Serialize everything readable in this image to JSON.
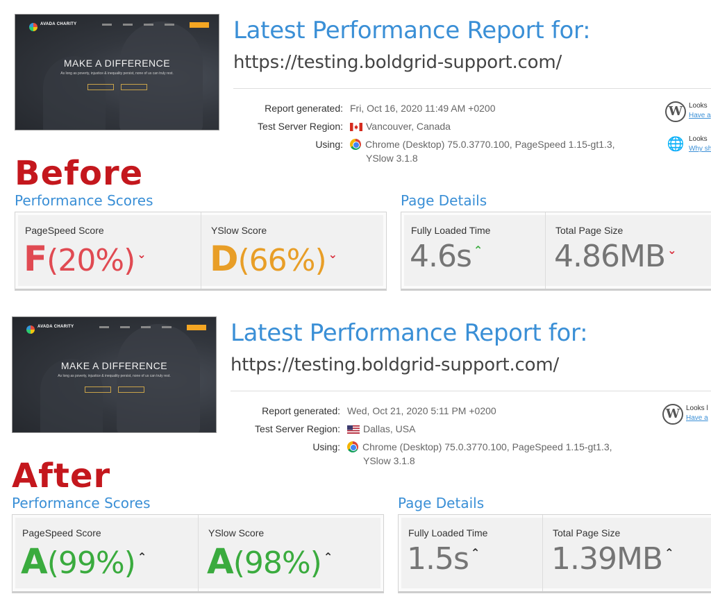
{
  "colors": {
    "accent": "#3a8fd6",
    "stage": "#c4171d",
    "grade_f": "#e04a52",
    "grade_d": "#e89e27",
    "grade_a": "#3aab3e",
    "neutral_value": "#757575",
    "arrow_up": "#3aab3e",
    "arrow_down": "#d9303e"
  },
  "before": {
    "thumb": {
      "brand": "AVADA CHARITY",
      "hero_title": "MAKE A DIFFERENCE",
      "hero_sub": "As long as poverty, injustice & inequality persist, none of us can truly rest."
    },
    "title": "Latest Performance Report for:",
    "url": "https://testing.boldgrid-support.com/",
    "report_label": "Report generated:",
    "report_value": "Fri, Oct 16, 2020 11:49 AM +0200",
    "region_label": "Test Server Region:",
    "region_value": "Vancouver, Canada",
    "region_flag": "canada-flag-icon",
    "using_label": "Using:",
    "using_line1": "Chrome (Desktop) 75.0.3770.100, PageSpeed 1.15-gt1.3,",
    "using_line2": "YSlow 3.1.8",
    "side1_text": "Looks",
    "side1_link": "Have a",
    "side2_text": "Looks",
    "side2_link": "Why sh",
    "stage_label": "Before",
    "perf_heading": "Performance Scores",
    "page_heading": "Page Details",
    "pagespeed_label": "PageSpeed Score",
    "pagespeed_grade": "F",
    "pagespeed_pct": "(20%)",
    "pagespeed_trend": "down",
    "yslow_label": "YSlow Score",
    "yslow_grade": "D",
    "yslow_pct": "(66%)",
    "yslow_trend": "down",
    "loaded_label": "Fully Loaded Time",
    "loaded_value": "4.6s",
    "loaded_trend": "up",
    "size_label": "Total Page Size",
    "size_value": "4.86MB",
    "size_trend": "down"
  },
  "after": {
    "thumb": {
      "brand": "AVADA CHARITY",
      "hero_title": "MAKE A DIFFERENCE",
      "hero_sub": "As long as poverty, injustice & inequality persist, none of us can truly rest."
    },
    "title": "Latest Performance Report for:",
    "url": "https://testing.boldgrid-support.com/",
    "report_label": "Report generated:",
    "report_value": "Wed, Oct 21, 2020 5:11 PM +0200",
    "region_label": "Test Server Region:",
    "region_value": "Dallas, USA",
    "region_flag": "usa-flag-icon",
    "using_label": "Using:",
    "using_line1": "Chrome (Desktop) 75.0.3770.100, PageSpeed 1.15-gt1.3,",
    "using_line2": "YSlow 3.1.8",
    "side1_text": "Looks l",
    "side1_link": "Have a",
    "stage_label": "After",
    "perf_heading": "Performance Scores",
    "page_heading": "Page Details",
    "pagespeed_label": "PageSpeed Score",
    "pagespeed_grade": "A",
    "pagespeed_pct": "(99%)",
    "pagespeed_trend": "up",
    "yslow_label": "YSlow Score",
    "yslow_grade": "A",
    "yslow_pct": "(98%)",
    "yslow_trend": "up",
    "loaded_label": "Fully Loaded Time",
    "loaded_value": "1.5s",
    "loaded_trend": "up",
    "size_label": "Total Page Size",
    "size_value": "1.39MB",
    "size_trend": "up"
  }
}
